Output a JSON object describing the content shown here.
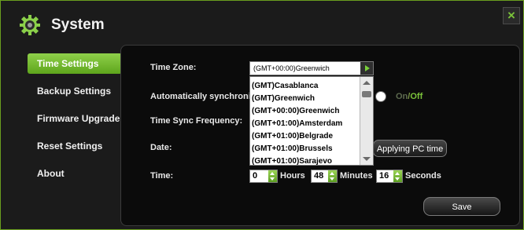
{
  "window": {
    "title": "System",
    "icons": {
      "app": "gear-icon",
      "close": "close-icon"
    },
    "close_label": "×"
  },
  "sidebar": {
    "items": [
      {
        "label": "Time Settings",
        "active": true
      },
      {
        "label": "Backup Settings"
      },
      {
        "label": "Firmware Upgrade"
      },
      {
        "label": "Reset Settings"
      },
      {
        "label": "About"
      }
    ]
  },
  "time_settings": {
    "timezone_label": "Time Zone:",
    "timezone_value": "(GMT+00:00)Greenwich",
    "timezone_options": [
      "(GMT)Casablanca",
      "(GMT)Greenwich",
      "(GMT+00:00)Greenwich",
      "(GMT+01:00)Amsterdam",
      "(GMT+01:00)Belgrade",
      "(GMT+01:00)Brussels",
      "(GMT+01:00)Sarajevo"
    ],
    "auto_sync_label": "Automatically synchroniz",
    "toggle_on": "On",
    "toggle_sep": "/",
    "toggle_off": "Off",
    "toggle_state": "off",
    "sync_freq_label": "Time Sync Frequency:",
    "date_label": "Date:",
    "apply_pc_time_button": "Applying PC time",
    "time_label": "Time:",
    "hours_value": "0",
    "hours_label": "Hours",
    "minutes_value": "48",
    "minutes_label": "Minutes",
    "seconds_value": "16",
    "seconds_label": "Seconds",
    "save_button": "Save"
  },
  "colors": {
    "accent": "#7ac23a",
    "background": "#1b1b1b",
    "panel": "#0b0b0b"
  }
}
